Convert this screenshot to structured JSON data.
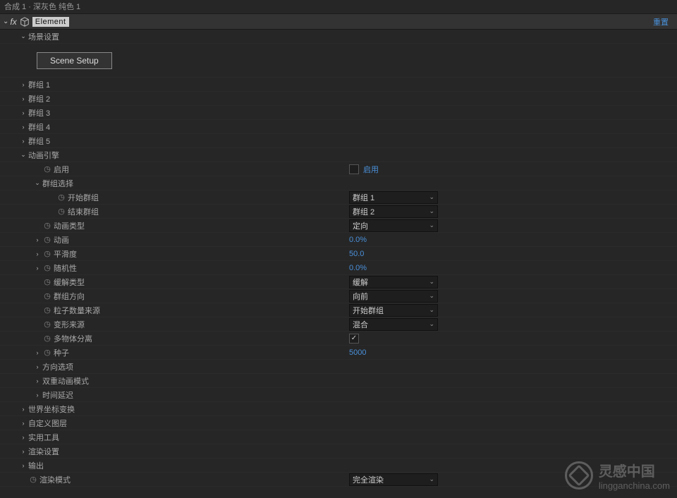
{
  "titlebar": "合成 1 · 深灰色 纯色 1",
  "fx": {
    "name": "Element",
    "reset": "重置"
  },
  "scene": {
    "header": "场景设置",
    "btn": "Scene Setup"
  },
  "groups": [
    "群组 1",
    "群组 2",
    "群组 3",
    "群组 4",
    "群组 5"
  ],
  "anim": {
    "header": "动画引擎",
    "enable": {
      "label": "启用",
      "cblabel": "启用"
    },
    "groupsel": {
      "header": "群组选择",
      "start": {
        "label": "开始群组",
        "value": "群组 1"
      },
      "end": {
        "label": "结束群组",
        "value": "群组 2"
      }
    },
    "type": {
      "label": "动画类型",
      "value": "定向"
    },
    "amount": {
      "label": "动画",
      "value": "0.0%"
    },
    "smooth": {
      "label": "平滑度",
      "value": "50.0"
    },
    "random": {
      "label": "随机性",
      "value": "0.0%"
    },
    "ease": {
      "label": "缓解类型",
      "value": "缓解"
    },
    "dir": {
      "label": "群组方向",
      "value": "向前"
    },
    "pcount": {
      "label": "粒子数量来源",
      "value": "开始群组"
    },
    "deform": {
      "label": "变形来源",
      "value": "混合"
    },
    "multi": {
      "label": "多物体分离"
    },
    "seed": {
      "label": "种子",
      "value": "5000"
    },
    "orient": "方向选项",
    "dual": "双重动画模式",
    "delay": "时间延迟"
  },
  "more": [
    "世界坐标变换",
    "自定义图层",
    "实用工具",
    "渲染设置",
    "输出"
  ],
  "rendermode": {
    "label": "渲染模式",
    "value": "完全渲染"
  },
  "watermark": {
    "main": "灵感中国",
    "sub": "lingganchina.com"
  }
}
